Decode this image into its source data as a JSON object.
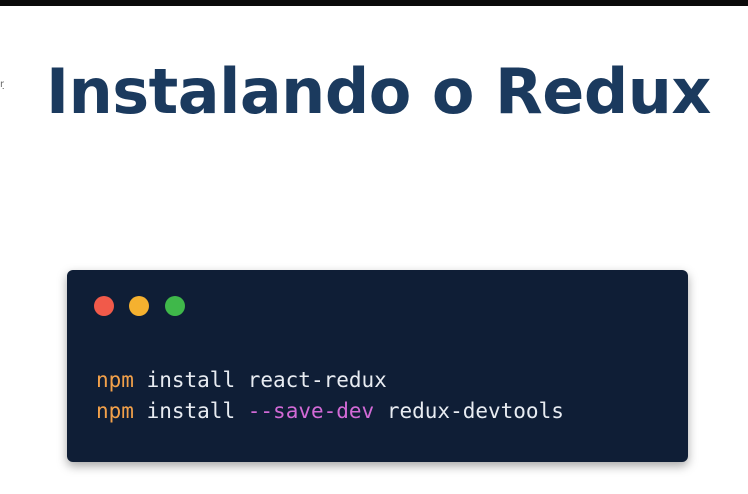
{
  "slide": {
    "title": "Instalando o Redux",
    "edge_mark": "ŋ"
  },
  "terminal": {
    "window_dots": [
      "close-dot",
      "minimize-dot",
      "maximize-dot"
    ],
    "lines": [
      {
        "cmd": "npm",
        "args": "install react-redux"
      },
      {
        "cmd": "npm",
        "args_pre": "install",
        "flag": "--save-dev",
        "args_post": "redux-devtools"
      }
    ]
  },
  "colors": {
    "title": "#1b3a5e",
    "terminal_bg": "#0f1e36",
    "dot_red": "#f15a4a",
    "dot_yellow": "#f5b12f",
    "dot_green": "#3fb84a",
    "cmd_token": "#f3a14a",
    "flag_token": "#d26ad6",
    "text": "#e8ecf2"
  }
}
